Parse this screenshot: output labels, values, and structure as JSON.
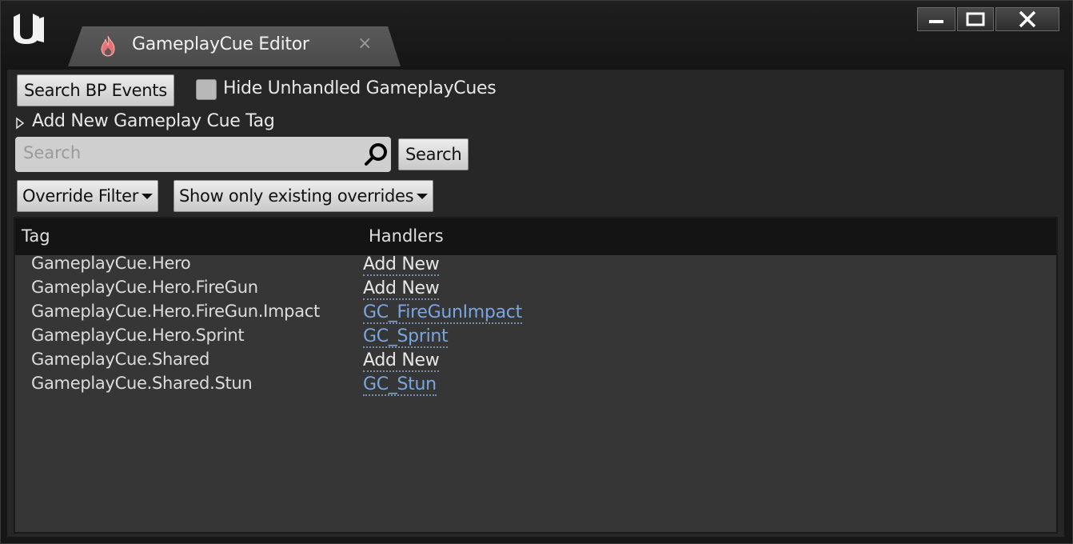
{
  "window": {
    "tab_title": "GameplayCue Editor",
    "tab_close": "×",
    "controls": [
      "minimize-icon",
      "maximize-icon",
      "close-icon"
    ]
  },
  "toolbar": {
    "search_bp_events_label": "Search BP Events",
    "hide_unhandled_label": "Hide Unhandled GameplayCues",
    "hide_unhandled_checked": false,
    "add_new_tag_label": "Add New Gameplay Cue Tag",
    "search_placeholder": "Search",
    "search_button_label": "Search",
    "override_filter_label": "Override Filter",
    "show_existing_label": "Show only existing overrides"
  },
  "table": {
    "columns": [
      "Tag",
      "Handlers"
    ],
    "rows": [
      {
        "tag": "GameplayCue.Hero",
        "handler": "Add New",
        "handler_type": "add"
      },
      {
        "tag": "GameplayCue.Hero.FireGun",
        "handler": "Add New",
        "handler_type": "add"
      },
      {
        "tag": "GameplayCue.Hero.FireGun.Impact",
        "handler": "GC_FireGunImpact",
        "handler_type": "link"
      },
      {
        "tag": "GameplayCue.Hero.Sprint",
        "handler": "GC_Sprint",
        "handler_type": "link"
      },
      {
        "tag": "GameplayCue.Shared",
        "handler": "Add New",
        "handler_type": "add"
      },
      {
        "tag": "GameplayCue.Shared.Stun",
        "handler": "GC_Stun",
        "handler_type": "link"
      }
    ]
  },
  "colors": {
    "link": "#7aa6e0",
    "add_new": "#e6e6e6",
    "panel": "#363636",
    "header": "#141414"
  }
}
